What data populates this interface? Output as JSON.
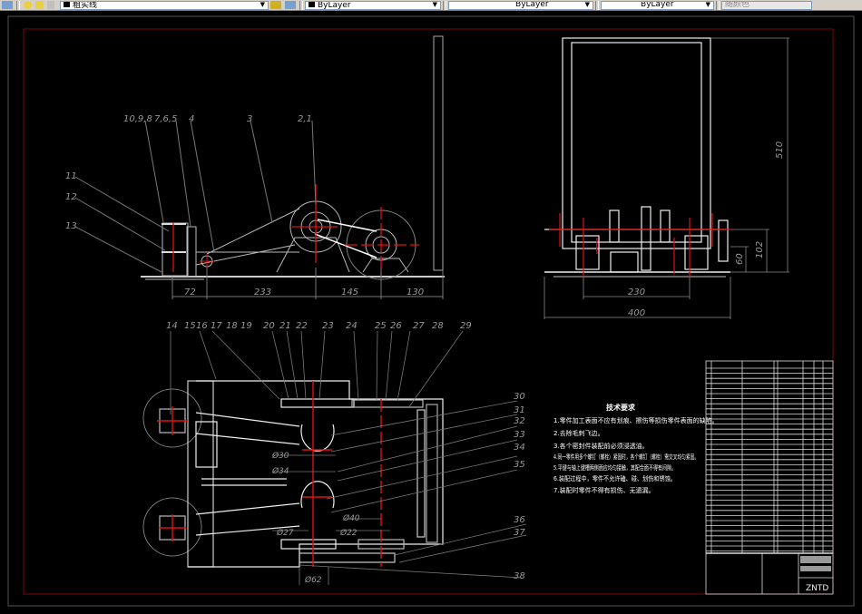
{
  "toolbar": {
    "layer_name": "粗实线",
    "color": "ByLayer",
    "linetype": "ByLayer",
    "lineweight": "ByLayer",
    "plotstyle": "随颜色"
  },
  "drawing": {
    "side_view": {
      "balloons": [
        "10,9,8",
        "7,6,5",
        "4",
        "3",
        "2,1",
        "11",
        "12",
        "13"
      ],
      "dims": [
        "72",
        "233",
        "145",
        "130"
      ]
    },
    "front_view": {
      "dims": [
        "510",
        "102",
        "60",
        "230",
        "400"
      ]
    },
    "top_view": {
      "balloons": [
        "14",
        "15",
        "16",
        "17",
        "18",
        "19",
        "20",
        "21",
        "22",
        "23",
        "24",
        "25",
        "26",
        "27",
        "28",
        "29",
        "30",
        "31",
        "32",
        "33",
        "34",
        "35",
        "36",
        "37",
        "38"
      ],
      "dims": [
        "Ø30",
        "Ø34",
        "Ø40",
        "Ø27",
        "Ø22",
        "Ø62"
      ]
    },
    "tech_req": {
      "title": "技术要求",
      "items": [
        "1.零件加工表面不应有划痕、擦伤等损伤零件表面的缺陷。",
        "2.去除毛刺飞边。",
        "3.各个密封件装配前必须浸透油。",
        "4.同一零件用多个螺钉（螺栓）紧固时，各个螺钉（螺栓）需交叉均匀紧固。",
        "5.平键与轴上键槽两侧面应均匀接触，其配合面不得有间隙。",
        "6.装配过程中，零件不允许磕、碰、划伤和锈蚀。",
        "7.装配时零件不得有损伤、无遗漏。"
      ]
    },
    "title_block": {
      "code": "ZNTD"
    }
  },
  "colors": {
    "line": "#e8e8e8",
    "center": "#e01010",
    "border": "#7a0a0a",
    "dim": "#9a9a9a"
  }
}
